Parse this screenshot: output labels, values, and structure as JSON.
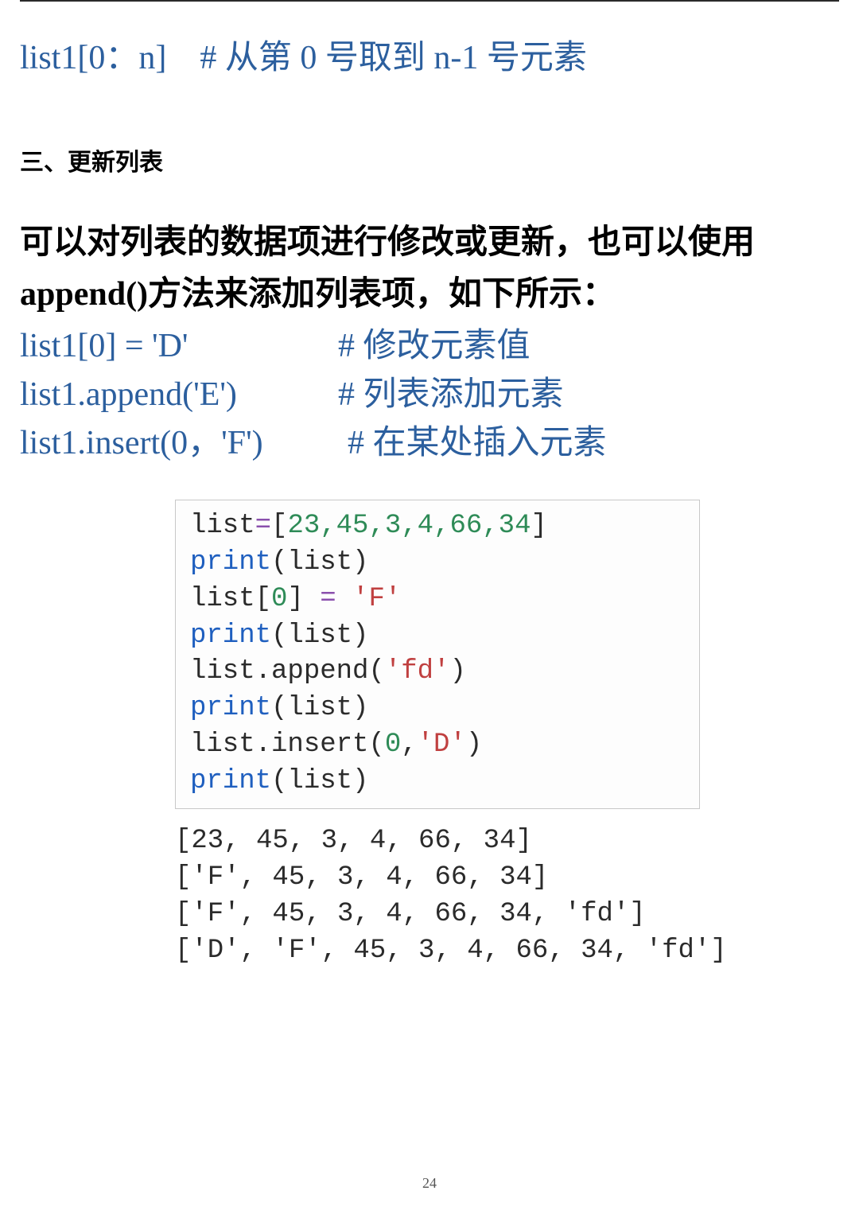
{
  "slice_line": {
    "code": "list1[0：n]",
    "comment": "#  从第 0 号取到 n-1 号元素"
  },
  "section_title": "三、更新列表",
  "body_para": "可以对列表的数据项进行修改或更新，也可以使用 append()方法来添加列表项，如下所示：",
  "update_lines": [
    {
      "code": "list1[0] = 'D'",
      "comment": "#  修改元素值"
    },
    {
      "code": "list1.append('E')",
      "comment": "#  列表添加元素"
    },
    {
      "code": "list1.insert(0，'F')",
      "comment": "#  在某处插入元素"
    }
  ],
  "code_block": {
    "l1_a": "list",
    "l1_eq": "=",
    "l1_b": "[",
    "l1_nums": "23,45,3,4,66,34",
    "l1_c": "]",
    "l2_a": "print",
    "l2_b": "(list)",
    "l3_a": "list[",
    "l3_idx": "0",
    "l3_b": "] ",
    "l3_eq": "= ",
    "l3_str": "'F'",
    "l4_a": "print",
    "l4_b": "(list)",
    "l5_a": "list.append(",
    "l5_str": "'fd'",
    "l5_b": ")",
    "l6_a": "print",
    "l6_b": "(list)",
    "l7_a": "list.insert(",
    "l7_idx": "0",
    "l7_c": ",",
    "l7_str": "'D'",
    "l7_b": ")",
    "l8_a": "print",
    "l8_b": "(list)"
  },
  "output_lines": [
    "[23, 45, 3, 4, 66, 34]",
    "['F', 45, 3, 4, 66, 34]",
    "['F', 45, 3, 4, 66, 34, 'fd']",
    "['D', 'F', 45, 3, 4, 66, 34, 'fd']"
  ],
  "page_number": "24"
}
